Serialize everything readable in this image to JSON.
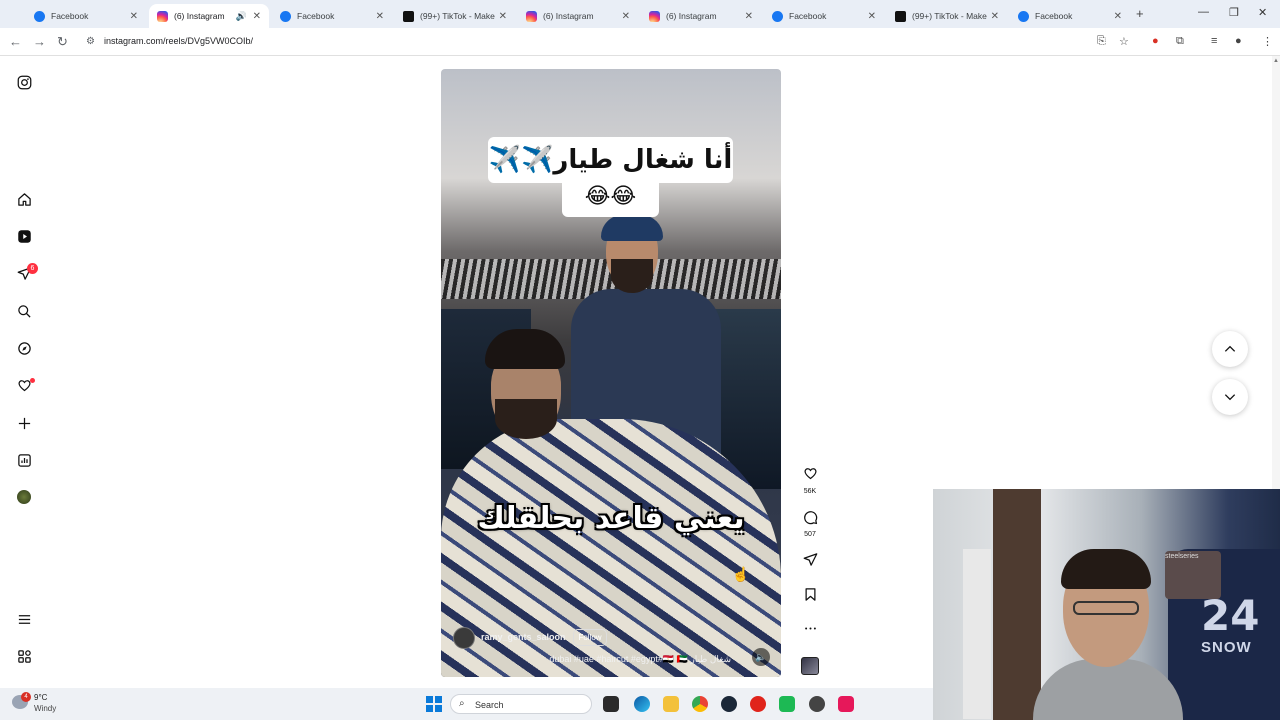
{
  "browser": {
    "tabs": [
      {
        "title": "Facebook",
        "favicon": "facebook-icon",
        "active": false
      },
      {
        "title": "(6) Instagram",
        "favicon": "instagram-icon",
        "active": true,
        "audio": true
      },
      {
        "title": "Facebook",
        "favicon": "facebook-icon",
        "active": false
      },
      {
        "title": "(99+) TikTok - Make Y",
        "favicon": "tiktok-icon",
        "active": false
      },
      {
        "title": "(6) Instagram",
        "favicon": "instagram-icon",
        "active": false
      },
      {
        "title": "(6) Instagram",
        "favicon": "instagram-icon",
        "active": false
      },
      {
        "title": "Facebook",
        "favicon": "facebook-icon",
        "active": false
      },
      {
        "title": "(99+) TikTok - Make Y",
        "favicon": "tiktok-icon",
        "active": false
      },
      {
        "title": "Facebook",
        "favicon": "facebook-icon",
        "active": false
      }
    ],
    "new_tab": "+",
    "url": "instagram.com/reels/DVg5VW0COIb/"
  },
  "sidebar": {
    "notifications_badge": "6"
  },
  "reel": {
    "caption_top": "أنا شغال طيار✈️✈️",
    "caption_emoji": "😂😂",
    "subtitle": "يعني قاعد بحلقلك",
    "author": "ramy_gents_saloon",
    "follow_label": "Follow",
    "description": "dubai #uae #haircut #egypt#🇪🇬 🇦🇪 شغال طيار",
    "likes": "56K",
    "comments": "507"
  },
  "taskbar": {
    "weather_temp": "9°C",
    "weather_desc": "Windy",
    "weather_badge": "4",
    "search_placeholder": "Search"
  },
  "webcam": {
    "jersey_number": "24",
    "jersey_text": "SNOW",
    "brand_text": "steelseries"
  },
  "colors": {
    "tabstrip_bg": "#e9eef6",
    "notification_red": "#ff3040",
    "facebook_blue": "#1877f2"
  }
}
